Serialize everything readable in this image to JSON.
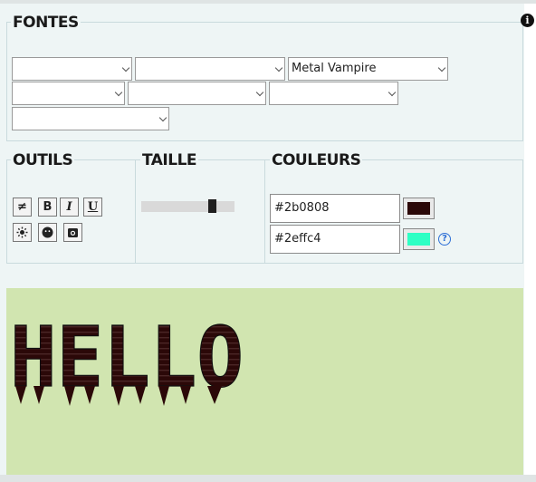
{
  "fonts_section": {
    "title": "FONTES",
    "selects": [
      "",
      "",
      "Metal Vampire",
      "",
      "",
      "",
      ""
    ]
  },
  "tools": {
    "title": "OUTILS",
    "buttons": [
      "≠",
      "B",
      "I",
      "U",
      "sun-icon",
      "face-icon",
      "camera-icon"
    ]
  },
  "size": {
    "title": "TAILLE",
    "level": 0.79
  },
  "colors": {
    "title": "COULEURS",
    "text_color": "#2b0808",
    "bg_color": "#2effc4"
  },
  "preview": {
    "text": "HELLO",
    "background": "#d1e5b0"
  },
  "info_icon": "i",
  "help_icon": "?"
}
